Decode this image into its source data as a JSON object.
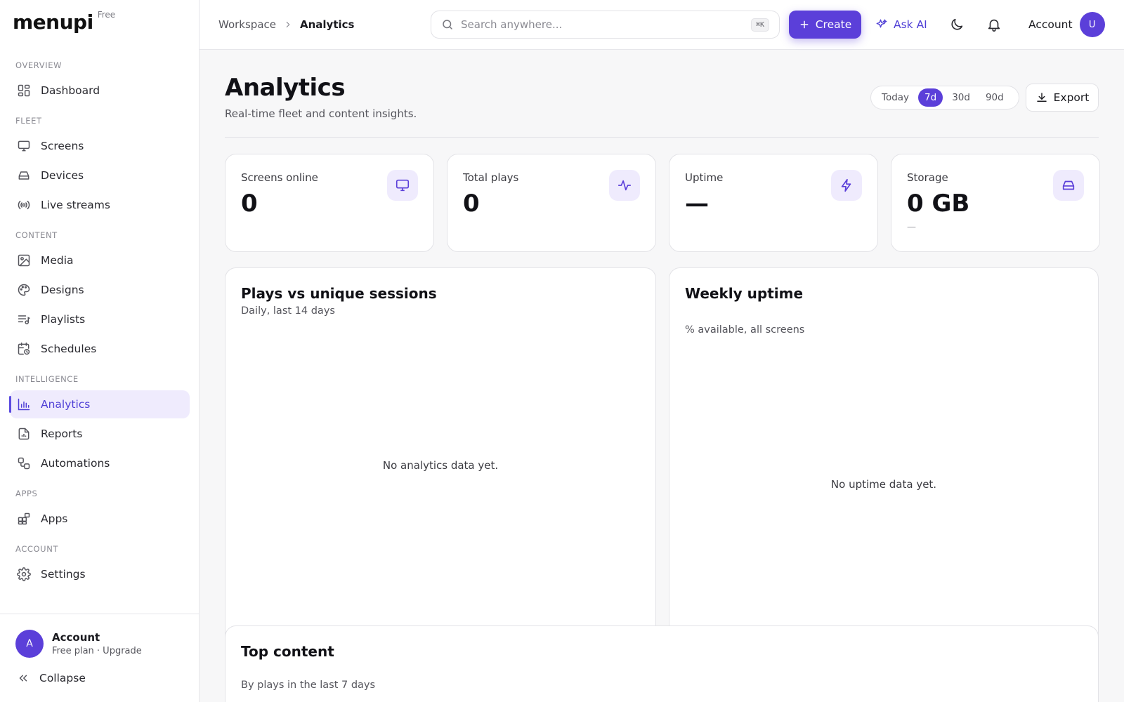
{
  "brand": {
    "name": "menupi",
    "plan": "Free"
  },
  "sidebar": {
    "sections": [
      {
        "heading": "OVERVIEW",
        "items": [
          {
            "label": "Dashboard",
            "icon": "dashboard-icon"
          }
        ]
      },
      {
        "heading": "FLEET",
        "items": [
          {
            "label": "Screens",
            "icon": "monitor-icon"
          },
          {
            "label": "Devices",
            "icon": "drive-icon"
          },
          {
            "label": "Live streams",
            "icon": "broadcast-icon"
          }
        ]
      },
      {
        "heading": "CONTENT",
        "items": [
          {
            "label": "Media",
            "icon": "image-icon"
          },
          {
            "label": "Designs",
            "icon": "palette-icon"
          },
          {
            "label": "Playlists",
            "icon": "playlist-icon"
          },
          {
            "label": "Schedules",
            "icon": "calendar-clock-icon"
          }
        ]
      },
      {
        "heading": "INTELLIGENCE",
        "items": [
          {
            "label": "Analytics",
            "icon": "bar-chart-icon",
            "active": true
          },
          {
            "label": "Reports",
            "icon": "report-icon"
          },
          {
            "label": "Automations",
            "icon": "workflow-icon"
          }
        ]
      },
      {
        "heading": "APPS",
        "items": [
          {
            "label": "Apps",
            "icon": "apps-icon"
          }
        ]
      },
      {
        "heading": "ACCOUNT",
        "items": [
          {
            "label": "Settings",
            "icon": "gear-icon"
          }
        ]
      }
    ],
    "footer": {
      "avatar_initial": "A",
      "name": "Account",
      "plan": "Free plan · Upgrade",
      "collapse_label": "Collapse"
    }
  },
  "topbar": {
    "breadcrumb": {
      "root": "Workspace",
      "current": "Analytics"
    },
    "search": {
      "placeholder": "Search anywhere...",
      "shortcut": "⌘K"
    },
    "create_label": "Create",
    "ask_ai_label": "Ask AI",
    "account_label": "Account",
    "account_initial": "U"
  },
  "page": {
    "title": "Analytics",
    "subtitle": "Real-time fleet and content insights.",
    "ranges": [
      "Today",
      "7d",
      "30d",
      "90d"
    ],
    "selected_range": "7d",
    "export_label": "Export"
  },
  "stats": [
    {
      "label": "Screens online",
      "value": "0",
      "sub": "",
      "icon": "monitor-icon"
    },
    {
      "label": "Total plays",
      "value": "0",
      "sub": "",
      "icon": "activity-icon"
    },
    {
      "label": "Uptime",
      "value": "—",
      "sub": "",
      "icon": "bolt-icon"
    },
    {
      "label": "Storage",
      "value": "0 GB",
      "sub": "—",
      "icon": "drive-icon"
    }
  ],
  "panels": {
    "plays": {
      "title": "Plays vs unique sessions",
      "subtitle": "Daily, last 14 days",
      "empty": "No analytics data yet."
    },
    "uptime": {
      "title": "Weekly uptime",
      "subtitle": "% available, all screens",
      "empty": "No uptime data yet."
    },
    "top_content": {
      "title": "Top content",
      "subtitle": "By plays in the last 7 days"
    }
  },
  "colors": {
    "accent": "#5b3fd9",
    "accent_soft": "#efebfd",
    "background": "#f7f7f8",
    "border": "#e3e3e7"
  }
}
